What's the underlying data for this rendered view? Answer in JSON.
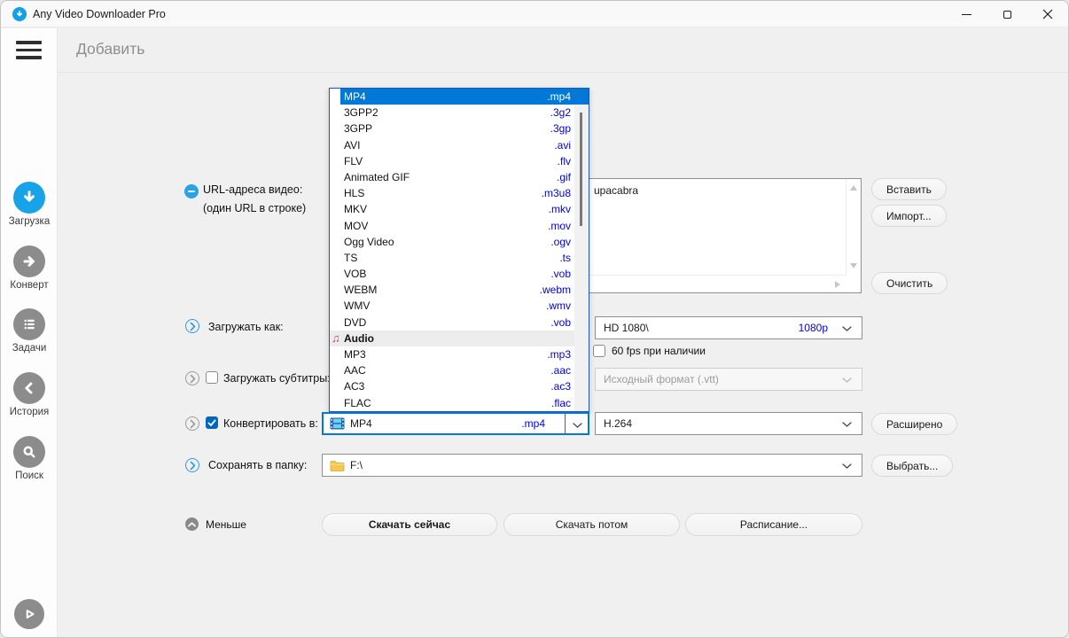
{
  "colors": {
    "accent_selection": "#0078d7",
    "link_blue": "#0000e0",
    "active_sidebar_icon": "#18a3e8",
    "checkbox_checked": "#0066bf",
    "audio_note_pink": "#e8318a"
  },
  "window": {
    "title": "Any Video Downloader Pro",
    "controls": [
      "minimize",
      "maximize",
      "close"
    ]
  },
  "header": {
    "title": "Добавить"
  },
  "sidebar": {
    "items": [
      {
        "label": "Загрузка",
        "icon": "download-icon",
        "active": true
      },
      {
        "label": "Конверт",
        "icon": "convert-arrow-icon",
        "active": false
      },
      {
        "label": "Задачи",
        "icon": "tasks-list-icon",
        "active": false
      },
      {
        "label": "История",
        "icon": "history-back-icon",
        "active": false
      },
      {
        "label": "Поиск",
        "icon": "search-icon",
        "active": false
      }
    ],
    "player_icon": "play-icon"
  },
  "form": {
    "url_label_line1": "URL-адреса видео:",
    "url_label_line2": "(один URL в строке)",
    "url_text": "upacabra",
    "paste_button": "Вставить",
    "import_button": "Импорт...",
    "clear_button": "Очистить",
    "download_as_label": "Загружать как:",
    "quality_value": "HD 1080\\",
    "quality_badge": "1080p",
    "fps_checkbox_label": "60 fps при наличии",
    "fps_checked": false,
    "subtitles_label": "Загружать субтитры:",
    "subtitles_checked": false,
    "subtitles_format_value": "Исходный формат (.vtt)",
    "convert_label": "Конвертировать в:",
    "convert_checked": true,
    "convert_format_name": "MP4",
    "convert_format_ext": ".mp4",
    "codec_value": "H.264",
    "advanced_button": "Расширено",
    "save_folder_label": "Сохранять в папку:",
    "folder_path": "F:\\",
    "choose_button": "Выбрать...",
    "less_label": "Меньше",
    "download_now_button": "Скачать сейчас",
    "download_later_button": "Скачать потом",
    "schedule_button": "Расписание..."
  },
  "format_dropdown": {
    "items": [
      {
        "name": "MP4",
        "ext": ".mp4",
        "selected": true
      },
      {
        "name": "3GPP2",
        "ext": ".3g2"
      },
      {
        "name": "3GPP",
        "ext": ".3gp"
      },
      {
        "name": "AVI",
        "ext": ".avi"
      },
      {
        "name": "FLV",
        "ext": ".flv"
      },
      {
        "name": "Animated GIF",
        "ext": ".gif"
      },
      {
        "name": "HLS",
        "ext": ".m3u8"
      },
      {
        "name": "MKV",
        "ext": ".mkv"
      },
      {
        "name": "MOV",
        "ext": ".mov"
      },
      {
        "name": "Ogg Video",
        "ext": ".ogv"
      },
      {
        "name": "TS",
        "ext": ".ts"
      },
      {
        "name": "VOB",
        "ext": ".vob"
      },
      {
        "name": "WEBM",
        "ext": ".webm"
      },
      {
        "name": "WMV",
        "ext": ".wmv"
      },
      {
        "name": "DVD",
        "ext": ".vob"
      },
      {
        "name": "Audio",
        "header": true
      },
      {
        "name": "MP3",
        "ext": ".mp3"
      },
      {
        "name": "AAC",
        "ext": ".aac"
      },
      {
        "name": "AC3",
        "ext": ".ac3"
      },
      {
        "name": "FLAC",
        "ext": ".flac"
      }
    ]
  }
}
